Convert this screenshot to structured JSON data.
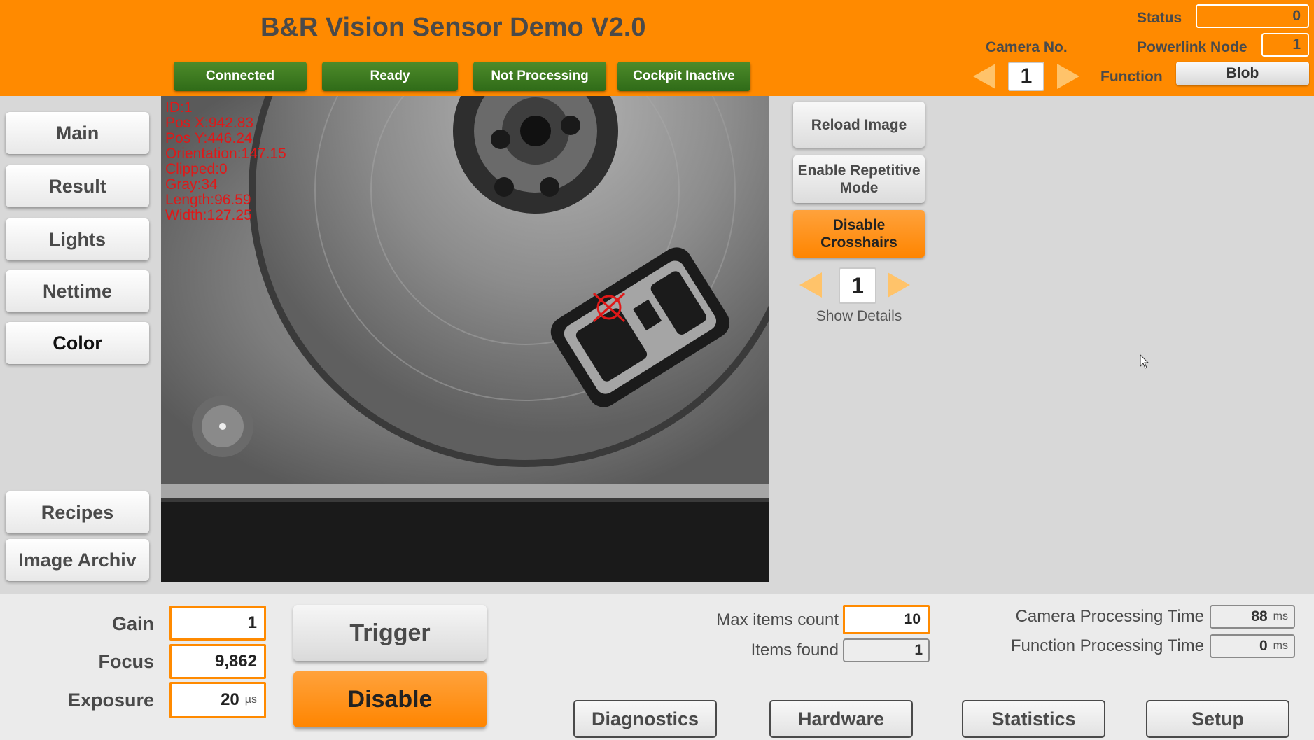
{
  "header": {
    "title": "B&R Vision Sensor Demo V2.0",
    "status_pills": [
      "Connected",
      "Ready",
      "Not Processing",
      "Cockpit Inactive"
    ],
    "status_label": "Status",
    "status_value": "0",
    "camera_label": "Camera No.",
    "camera_value": "1",
    "powerlink_label": "Powerlink Node",
    "powerlink_value": "1",
    "function_label": "Function",
    "function_value": "Blob"
  },
  "nav": {
    "items": [
      "Main",
      "Result",
      "Lights",
      "Nettime",
      "Color"
    ],
    "bottom_items": [
      "Recipes",
      "Image Archiv"
    ],
    "active": "Color"
  },
  "overlay": {
    "lines": [
      "ID:1",
      "Pos X:942.83",
      "Pos Y:446.24",
      "Orientation:147.15",
      "Clipped:0",
      "Gray:34",
      "Length:96.59",
      "Width:127.25"
    ]
  },
  "side": {
    "reload_label": "Reload Image",
    "repetitive_label": "Enable Repetitive Mode",
    "crosshairs_label": "Disable Crosshairs",
    "details_value": "1",
    "details_label": "Show Details"
  },
  "bottom": {
    "gain_label": "Gain",
    "gain_value": "1",
    "focus_label": "Focus",
    "focus_value": "9,862",
    "exposure_label": "Exposure",
    "exposure_value": "20",
    "exposure_unit": "µs",
    "trigger_label": "Trigger",
    "disable_label": "Disable",
    "max_items_label": "Max items count",
    "max_items_value": "10",
    "items_found_label": "Items found",
    "items_found_value": "1",
    "cam_proc_label": "Camera Processing Time",
    "cam_proc_value": "88",
    "cam_proc_unit": "ms",
    "func_proc_label": "Function Processing Time",
    "func_proc_value": "0",
    "func_proc_unit": "ms",
    "tabs": [
      "Diagnostics",
      "Hardware",
      "Statistics",
      "Setup"
    ]
  },
  "colors": {
    "brand_orange": "#ff8a00",
    "status_green": "#3b7a20",
    "overlay_red": "#e01818"
  }
}
